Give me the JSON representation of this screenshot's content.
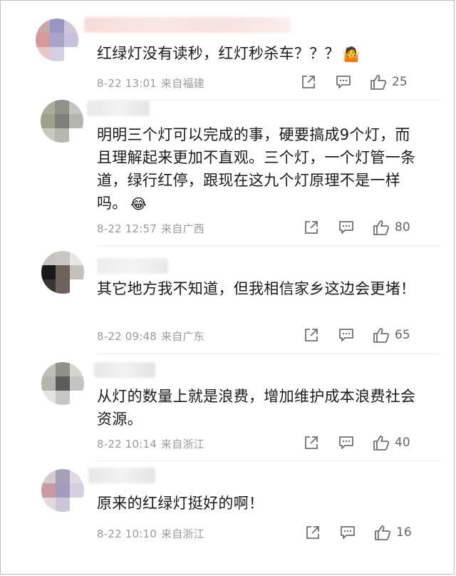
{
  "comments": [
    {
      "text": "红绿灯没有读秒，红灯秒杀车？？？",
      "emoji": "🤷",
      "emoji_name": "shrug-emoji",
      "time": "8-22 13:01",
      "location": "来自福建",
      "likes": "25"
    },
    {
      "text": "明明三个灯可以完成的事，硬要搞成9个灯，而且理解起来更加不直观。三个灯，一个灯管一条道，绿行红停，跟现在这九个灯原理不是一样吗。",
      "emoji": "😂",
      "emoji_name": "laughing-tears-emoji",
      "time": "8-22 12:57",
      "location": "来自广西",
      "likes": "80"
    },
    {
      "text": "其它地方我不知道，但我相信家乡这边会更堵！",
      "time": "8-22 09:48",
      "location": "来自广东",
      "likes": "65"
    },
    {
      "text": "从灯的数量上就是浪费，增加维护成本浪费社会资源。",
      "time": "8-22 10:14",
      "location": "来自浙江",
      "likes": "40"
    },
    {
      "text": "原来的红绿灯挺好的啊！",
      "time": "8-22 10:10",
      "location": "来自浙江",
      "likes": "16"
    }
  ],
  "icons": {
    "share": "share-icon",
    "reply": "comment-icon",
    "like": "thumbs-up-icon"
  },
  "colors": {
    "text": "#1a1a1a",
    "meta": "#9a9a9a",
    "icon": "#707070"
  }
}
